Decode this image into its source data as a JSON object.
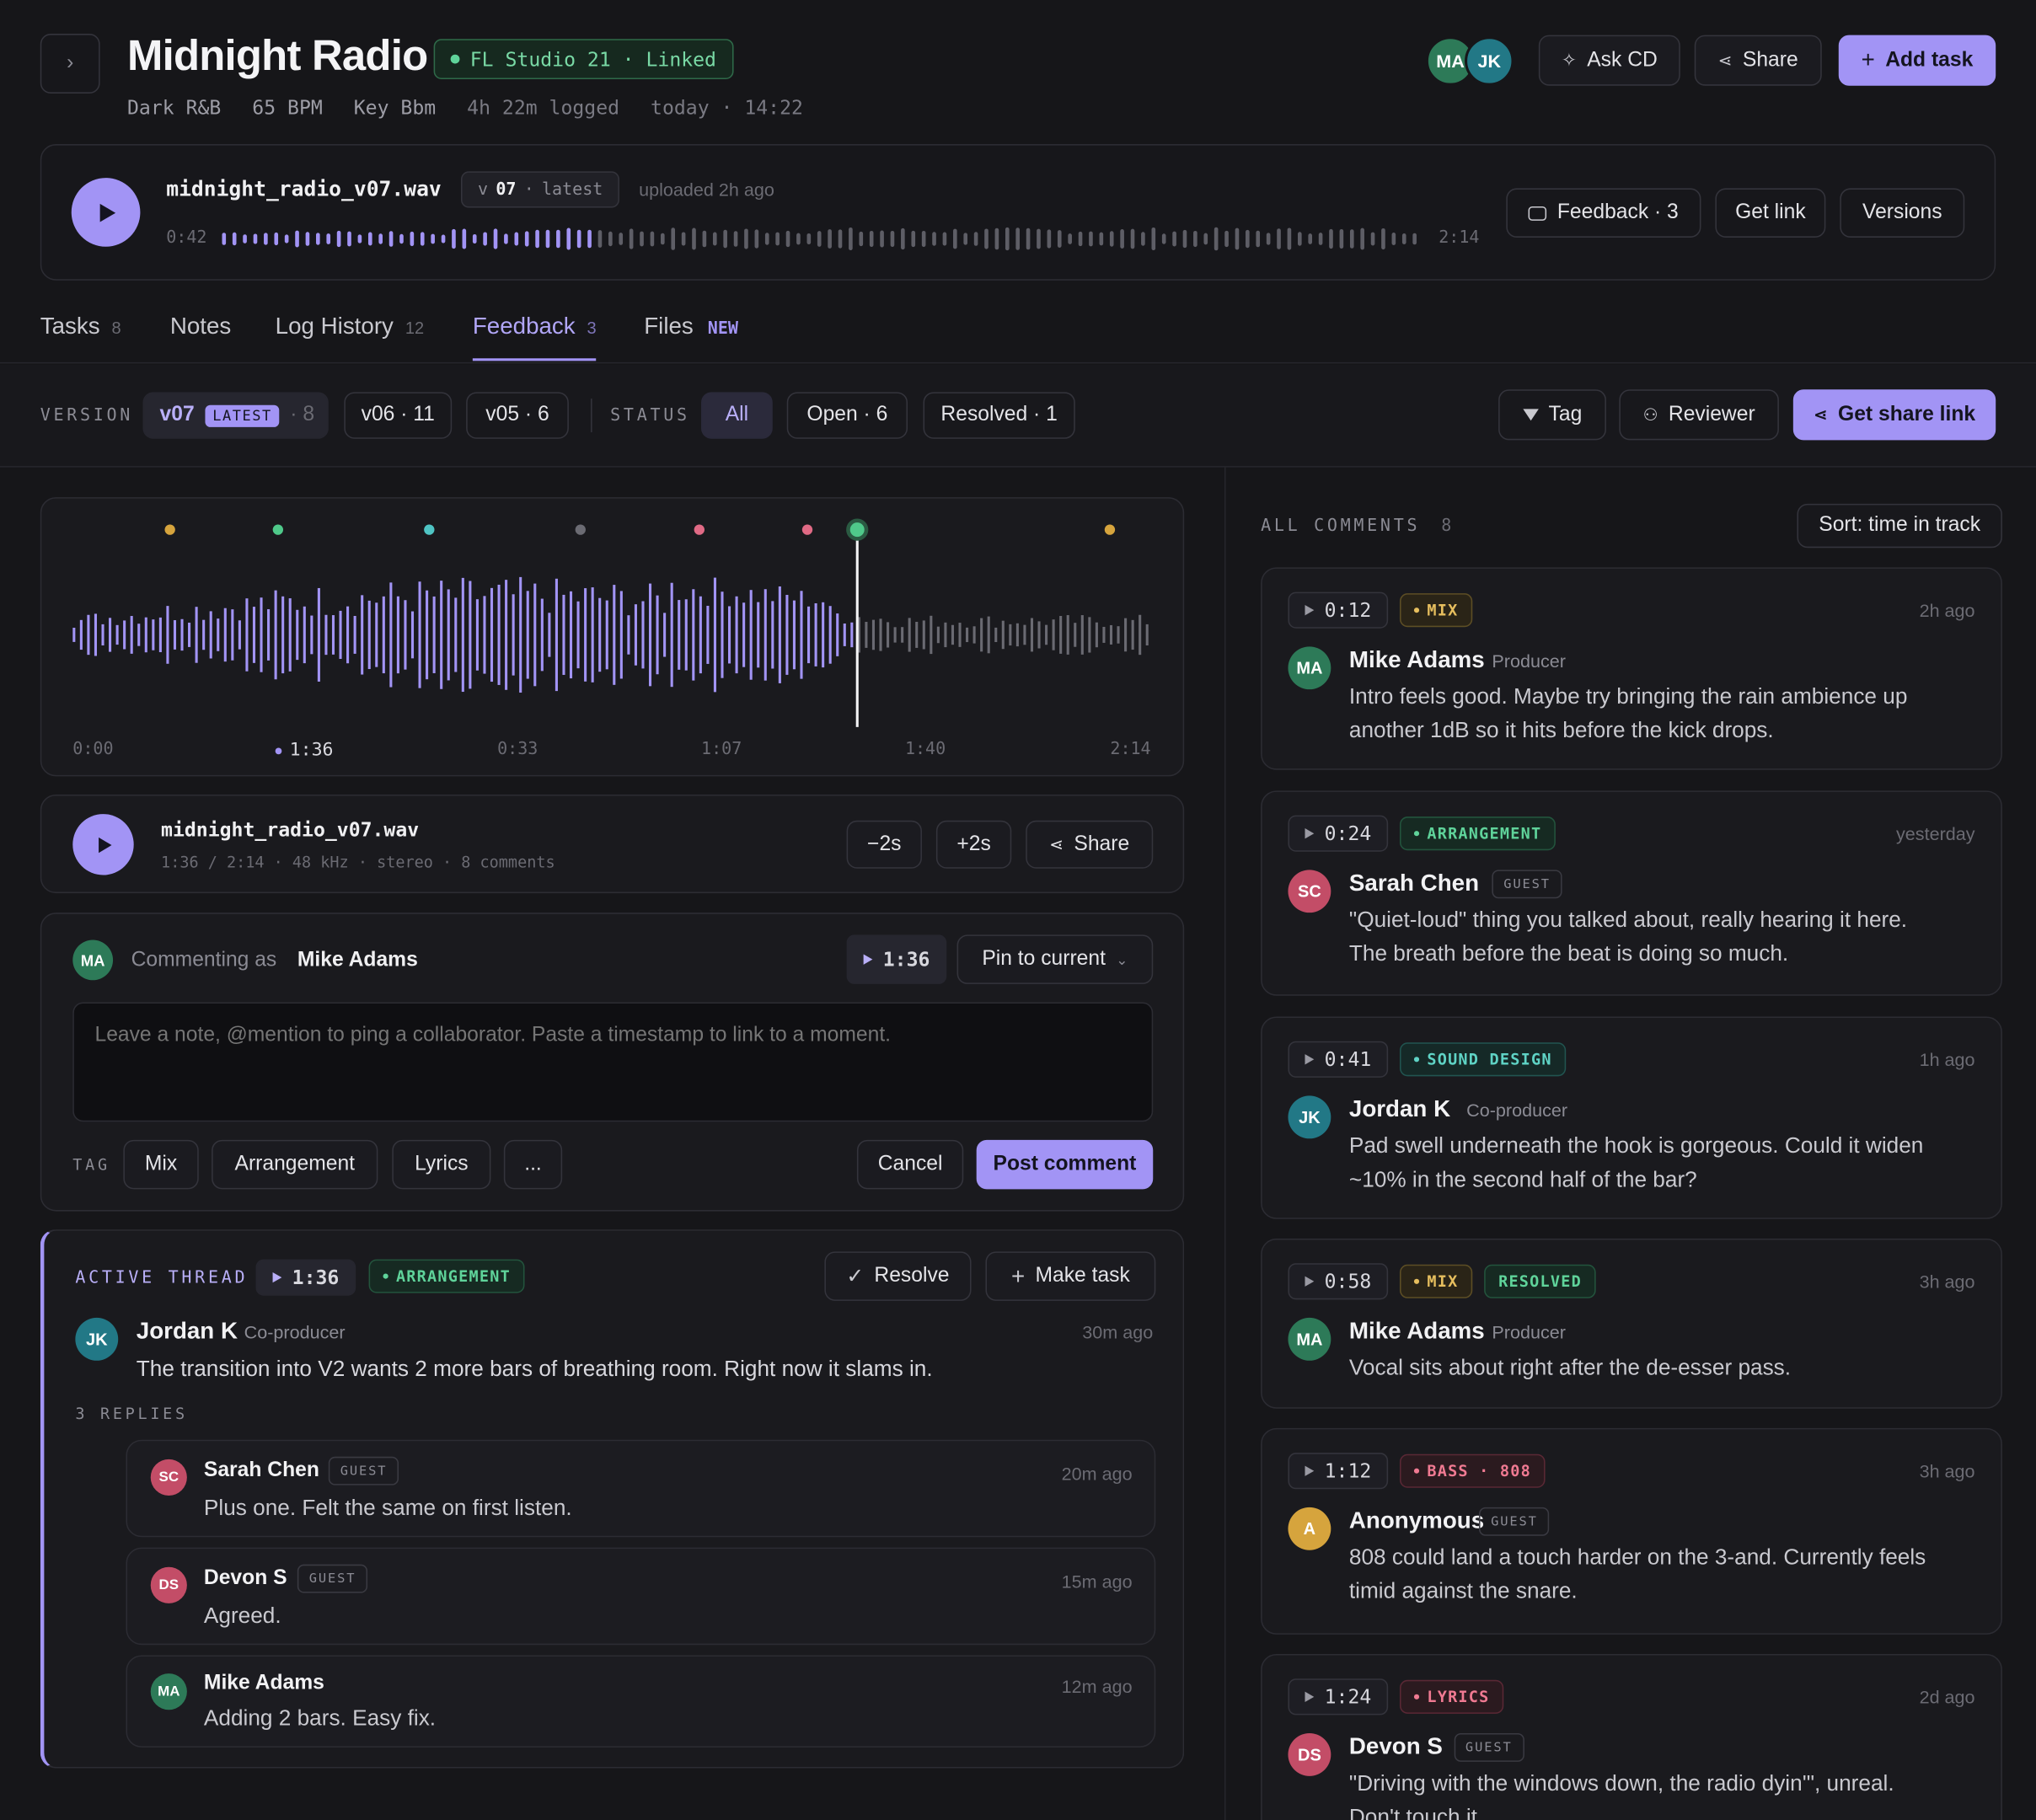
{
  "header": {
    "title": "Midnight Radio",
    "daw_badge": "FL Studio 21 · Linked",
    "genre": "Dark R&B",
    "bpm": "65 BPM",
    "key": "Key Bbm",
    "logged": "4h 22m logged",
    "updated": "today · 14:22",
    "avatars": [
      "MA",
      "JK"
    ],
    "ask_label": "Ask CD",
    "share_label": "Share",
    "add_task_label": "Add task"
  },
  "player": {
    "filename": "midnight_radio_v07.wav",
    "version_prefix": "v",
    "version": "07",
    "version_note": "latest",
    "uploaded": "uploaded 2h ago",
    "elapsed": "0:42",
    "duration": "2:14",
    "progress": 0.31,
    "feedback_label": "Feedback · 3",
    "getlink_label": "Get link",
    "versions_label": "Versions"
  },
  "tabs": [
    {
      "label": "Tasks",
      "count": "8"
    },
    {
      "label": "Notes",
      "count": ""
    },
    {
      "label": "Log History",
      "count": "12"
    },
    {
      "label": "Feedback",
      "count": "3",
      "active": true
    },
    {
      "label": "Files",
      "count": "NEW"
    }
  ],
  "filters": {
    "version_label": "VERSION",
    "v07": "v07",
    "latest": "LATEST",
    "v07_count": "· 8",
    "v06": "v06 · 11",
    "v05": "v05 · 6",
    "status_label": "STATUS",
    "all": "All",
    "open": "Open · 6",
    "resolved": "Resolved · 1",
    "tag": "Tag",
    "reviewer": "Reviewer",
    "share_link": "Get share link"
  },
  "waveform": {
    "axis": [
      "0:00",
      "1:36",
      "0:33",
      "1:07",
      "1:40",
      "2:14"
    ],
    "playhead_fraction": 0.725,
    "markers": [
      {
        "pos": 0.09,
        "color": "#d6a43d"
      },
      {
        "pos": 0.19,
        "color": "#4fc98a"
      },
      {
        "pos": 0.33,
        "color": "#4fc4c4"
      },
      {
        "pos": 0.47,
        "color": "#6b6b73"
      },
      {
        "pos": 0.58,
        "color": "#e06a85"
      },
      {
        "pos": 0.68,
        "color": "#e06a85"
      },
      {
        "pos": 0.72,
        "color": "#4fc98a"
      },
      {
        "pos": 0.96,
        "color": "#d6a43d"
      }
    ]
  },
  "mini_player": {
    "filename": "midnight_radio_v07.wav",
    "meta": "1:36 / 2:14 · 48 kHz · stereo · 8 comments",
    "back": "−2s",
    "fwd": "+2s",
    "share": "Share"
  },
  "composer": {
    "avatar": "MA",
    "commenting_as": "Commenting as",
    "user": "Mike Adams",
    "timestamp": "1:36",
    "pin": "Pin to current",
    "placeholder": "Leave a note, @mention to ping a collaborator. Paste a timestamp to link to a moment.",
    "tag_label": "TAG",
    "tags": [
      "Mix",
      "Arrangement",
      "Lyrics",
      "..."
    ],
    "cancel": "Cancel",
    "post": "Post comment"
  },
  "thread": {
    "label": "ACTIVE THREAD",
    "timestamp": "1:36",
    "tag": "ARRANGEMENT",
    "resolve": "Resolve",
    "make_task": "Make task",
    "author": "Jordan K",
    "role": "Co-producer",
    "avatar": "JK",
    "time": "30m ago",
    "text": "The transition into V2 wants 2 more bars of breathing room. Right now it slams in.",
    "replies_label": "3 REPLIES",
    "replies": [
      {
        "avatar": "SC",
        "name": "Sarah Chen",
        "badge": "GUEST",
        "time": "20m ago",
        "text": "Plus one. Felt the same on first listen."
      },
      {
        "avatar": "DS",
        "name": "Devon S",
        "badge": "GUEST",
        "time": "15m ago",
        "text": "Agreed."
      },
      {
        "avatar": "MA",
        "name": "Mike Adams",
        "badge": "",
        "time": "12m ago",
        "text": "Adding 2 bars. Easy fix."
      }
    ]
  },
  "comments": {
    "label": "ALL COMMENTS",
    "count": "8",
    "sort": "Sort: time in track",
    "items": [
      {
        "ts": "0:12",
        "tag": "MIX",
        "resolved": "",
        "time": "2h ago",
        "avatar": "MA",
        "name": "Mike Adams",
        "role": "Producer",
        "badge": "",
        "l1": "Intro feels good. Maybe try bringing the rain ambience up",
        "l2": "another 1dB so it hits before the kick drops."
      },
      {
        "ts": "0:24",
        "tag": "ARRANGEMENT",
        "resolved": "",
        "time": "yesterday",
        "avatar": "SC",
        "name": "Sarah Chen",
        "role": "",
        "badge": "GUEST",
        "l1": "\"Quiet-loud\" thing you talked about, really hearing it here.",
        "l2": "The breath before the beat is doing so much."
      },
      {
        "ts": "0:41",
        "tag": "SOUND DESIGN",
        "resolved": "",
        "time": "1h ago",
        "avatar": "JK",
        "name": "Jordan K",
        "role": "Co-producer",
        "badge": "",
        "l1": "Pad swell underneath the hook is gorgeous. Could it widen",
        "l2": "~10% in the second half of the bar?"
      },
      {
        "ts": "0:58",
        "tag": "MIX",
        "resolved": "RESOLVED",
        "time": "3h ago",
        "avatar": "MA",
        "name": "Mike Adams",
        "role": "Producer",
        "badge": "",
        "l1": "Vocal sits about right after the de-esser pass.",
        "l2": ""
      },
      {
        "ts": "1:12",
        "tag": "BASS · 808",
        "resolved": "",
        "time": "3h ago",
        "avatar": "A",
        "name": "Anonymous",
        "role": "",
        "badge": "GUEST",
        "l1": "808 could land a touch harder on the 3-and. Currently feels",
        "l2": "timid against the snare."
      },
      {
        "ts": "1:24",
        "tag": "LYRICS",
        "resolved": "",
        "time": "2d ago",
        "avatar": "DS",
        "name": "Devon S",
        "role": "",
        "badge": "GUEST",
        "l1": "\"Driving with the windows down, the radio dyin'\", unreal.",
        "l2": "Don't touch it."
      }
    ]
  },
  "colors": {
    "accent": "#a294f5",
    "bg": "#161619",
    "card": "#1a1a1e",
    "green": "#5fd39a"
  }
}
